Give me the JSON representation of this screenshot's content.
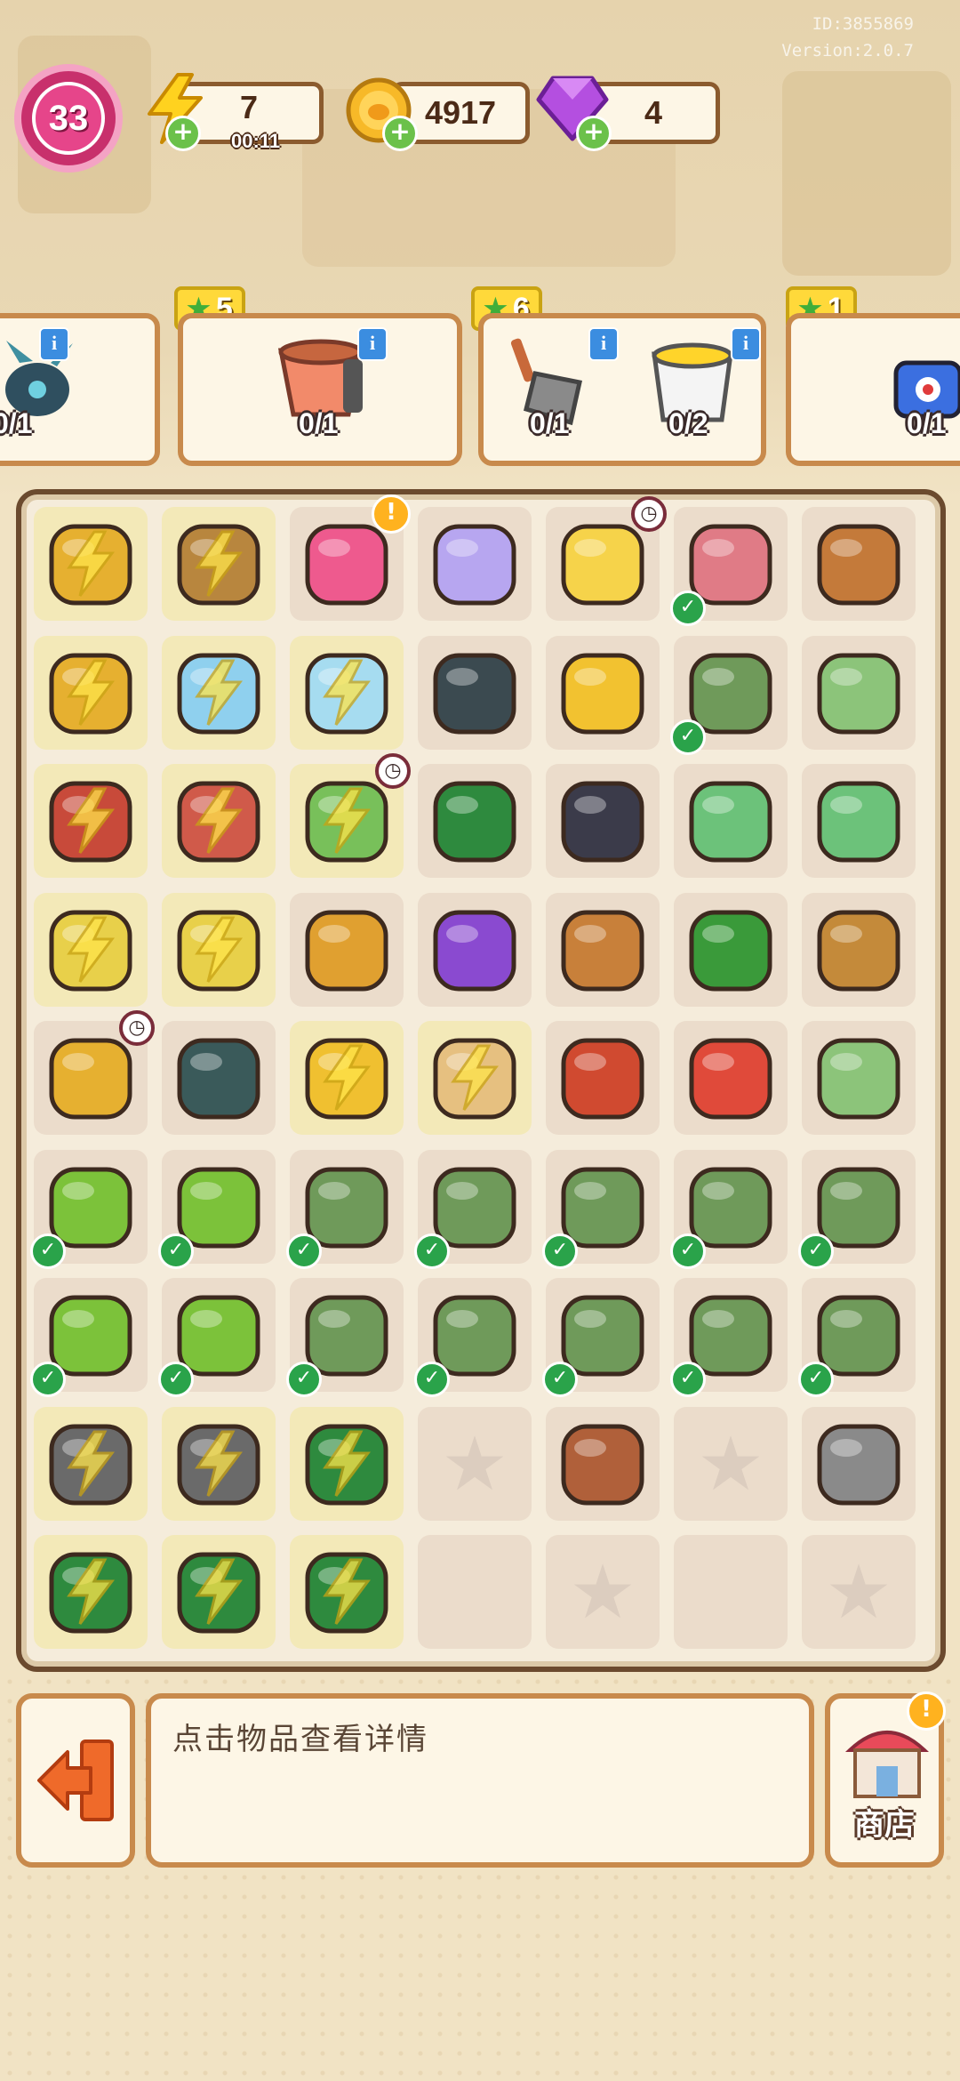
{
  "dev": {
    "id": "ID:3855869",
    "version": "Version:2.0.7"
  },
  "hud": {
    "level": "33",
    "energy": {
      "value": "7",
      "timer": "00:11"
    },
    "coins": {
      "value": "4917"
    },
    "gems": {
      "value": "4"
    }
  },
  "orders": [
    {
      "stars": "",
      "items": [
        {
          "progress": "0/1",
          "icon": "robot-toy-icon"
        }
      ]
    },
    {
      "stars": "5",
      "items": [
        {
          "progress": "0/1",
          "icon": "flower-pot-icon"
        }
      ]
    },
    {
      "stars": "6",
      "items": [
        {
          "progress": "0/1",
          "icon": "shovel-icon"
        },
        {
          "progress": "0/2",
          "icon": "paint-bucket-icon"
        }
      ]
    },
    {
      "stars": "1",
      "items": [
        {
          "progress": "0/1",
          "icon": "tape-dispenser-icon"
        }
      ]
    }
  ],
  "board": {
    "rows": [
      [
        {
          "icon": "seedling-cup-icon",
          "locked": true
        },
        {
          "icon": "wicker-basket-icon",
          "locked": true
        },
        {
          "icon": "backpack-icon",
          "alert": true
        },
        {
          "icon": "beach-ball-icon"
        },
        {
          "icon": "duck-float-icon",
          "timer": true
        },
        {
          "icon": "brick-pallet-icon",
          "check": true
        },
        {
          "icon": "clay-pot-icon"
        }
      ],
      [
        {
          "icon": "planter-cart-icon",
          "locked": true
        },
        {
          "icon": "printer-icon",
          "locked": true
        },
        {
          "icon": "robot-vacuum-icon",
          "locked": true
        },
        {
          "icon": "ab-roller-icon"
        },
        {
          "icon": "gold-medal-icon"
        },
        {
          "icon": "work-gloves-icon",
          "check": true
        },
        {
          "icon": "green-gloves-icon"
        }
      ],
      [
        {
          "icon": "wheelbarrow-icon",
          "locked": true
        },
        {
          "icon": "tool-crate-icon",
          "locked": true
        },
        {
          "icon": "laptop-icon",
          "locked": true,
          "timer": true
        },
        {
          "icon": "green-toolbox-icon"
        },
        {
          "icon": "boxing-glove-icon"
        },
        {
          "icon": "cash-stack-icon"
        },
        {
          "icon": "cash-pile-icon"
        }
      ],
      [
        {
          "icon": "toy-cart-icon",
          "locked": true
        },
        {
          "icon": "gym-cart-icon",
          "locked": true
        },
        {
          "icon": "wooden-drawers-icon"
        },
        {
          "icon": "purple-bin-icon"
        },
        {
          "icon": "tree-stump-icon"
        },
        {
          "icon": "garden-pliers-icon"
        },
        {
          "icon": "empty-basket-icon"
        }
      ],
      [
        {
          "icon": "cabinet-icon",
          "timer": true
        },
        {
          "icon": "closed-sign-icon"
        },
        {
          "icon": "shopping-cart-icon",
          "locked": true
        },
        {
          "icon": "plant-box-icon",
          "locked": true
        },
        {
          "icon": "drill-icon"
        },
        {
          "icon": "paint-can-icon"
        },
        {
          "icon": "single-glove-icon"
        }
      ],
      [
        {
          "icon": "potted-tree-icon",
          "check": true
        },
        {
          "icon": "potted-tree-icon",
          "check": true
        },
        {
          "icon": "work-gloves-icon",
          "check": true
        },
        {
          "icon": "work-gloves-icon",
          "check": true
        },
        {
          "icon": "work-gloves-icon",
          "check": true
        },
        {
          "icon": "work-gloves-icon",
          "check": true
        },
        {
          "icon": "work-gloves-icon",
          "check": true
        }
      ],
      [
        {
          "icon": "potted-tree-icon",
          "check": true
        },
        {
          "icon": "potted-tree-icon",
          "check": true
        },
        {
          "icon": "work-gloves-icon",
          "check": true
        },
        {
          "icon": "work-gloves-icon",
          "check": true
        },
        {
          "icon": "work-gloves-icon",
          "check": true
        },
        {
          "icon": "work-gloves-icon",
          "check": true
        },
        {
          "icon": "work-gloves-icon",
          "check": true
        }
      ],
      [
        {
          "icon": "gift-sack-icon",
          "locked": true
        },
        {
          "icon": "gift-sack-icon",
          "locked": true
        },
        {
          "icon": "toolbox-icon",
          "locked": true
        },
        {
          "icon": "empty-star-icon",
          "empty": true
        },
        {
          "icon": "wallet-icon"
        },
        {
          "icon": "empty-star-icon",
          "empty": true
        },
        {
          "icon": "wrench-icon"
        }
      ],
      [
        {
          "icon": "money-toolbox-icon",
          "locked": true
        },
        {
          "icon": "money-toolbox-icon",
          "locked": true
        },
        {
          "icon": "open-toolbox-icon",
          "locked": true
        },
        {
          "icon": "empty-cell",
          "blank": true
        },
        {
          "icon": "empty-star-icon",
          "empty": true
        },
        {
          "icon": "empty-cell",
          "blank": true
        },
        {
          "icon": "empty-star-icon",
          "empty": true
        }
      ]
    ]
  },
  "bottom": {
    "hint": "点击物品查看详情",
    "shop_label": "商店"
  },
  "colors": {
    "check": "#2aa34a",
    "frame": "#c88a4c",
    "board_border": "#6b4a2e"
  }
}
